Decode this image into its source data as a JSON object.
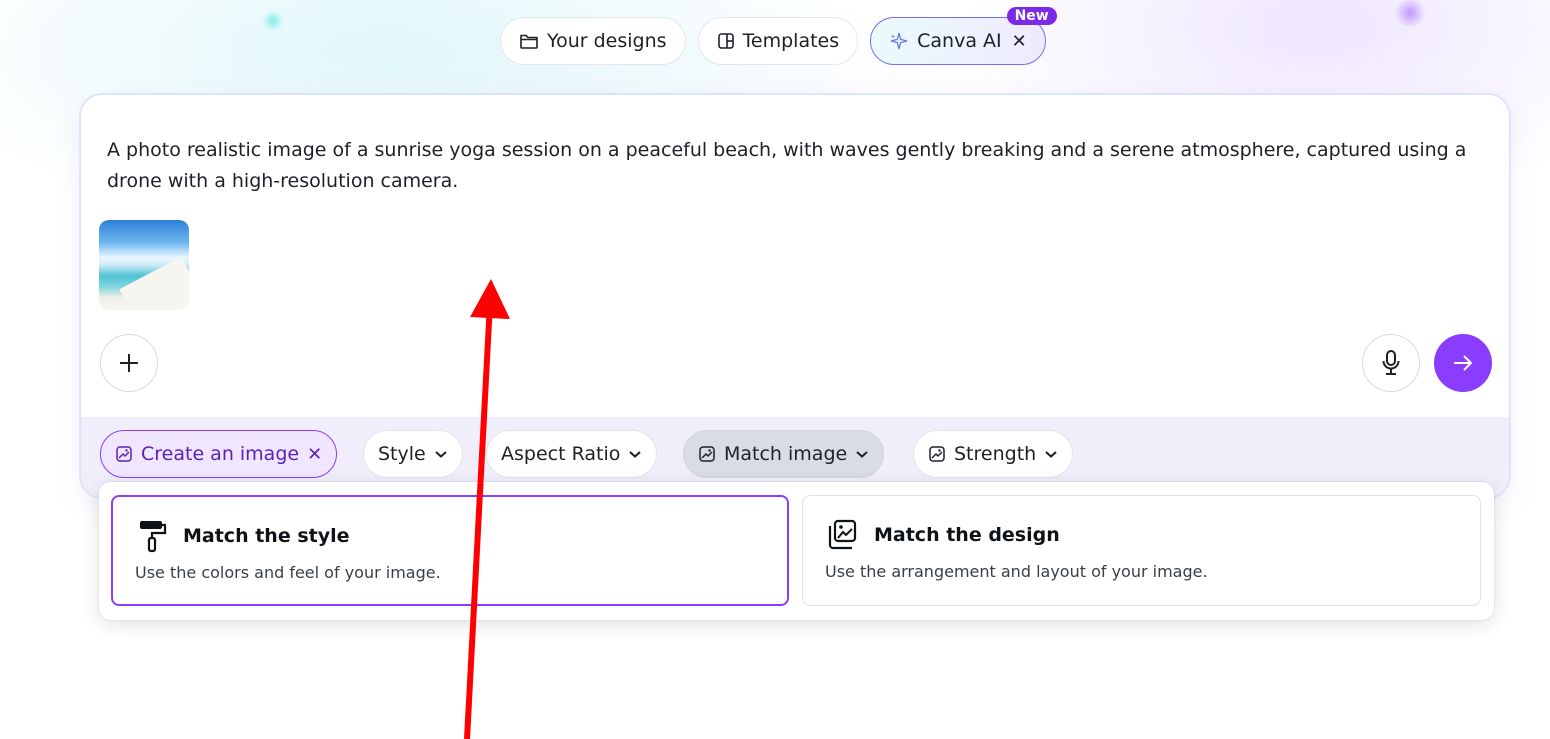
{
  "top_tabs": [
    {
      "label": "Your designs",
      "icon": "folder-icon"
    },
    {
      "label": "Templates",
      "icon": "template-icon"
    },
    {
      "label": "Canva AI",
      "icon": "sparkle-icon",
      "badge": "New",
      "close": "✕"
    }
  ],
  "prompt": {
    "text": "A photo realistic image of a sunrise yoga session on a peaceful beach, with waves gently breaking and a serene atmosphere, captured using a drone with a high-resolution camera.",
    "attachment": "beach-image-thumbnail"
  },
  "actions": {
    "add_icon": "plus-icon",
    "mic_icon": "microphone-icon",
    "send_icon": "arrow-right-icon"
  },
  "options": {
    "create": {
      "label": "Create an image",
      "close": "✕"
    },
    "style": {
      "label": "Style"
    },
    "aspect": {
      "label": "Aspect Ratio"
    },
    "match": {
      "label": "Match image"
    },
    "strength": {
      "label": "Strength"
    }
  },
  "match_menu": [
    {
      "title": "Match the style",
      "desc": "Use the colors and feel of your image.",
      "icon": "paint-roller-icon",
      "selected": true
    },
    {
      "title": "Match the design",
      "desc": "Use the arrangement and layout of your image.",
      "icon": "image-layout-icon",
      "selected": false
    }
  ],
  "colors": {
    "accent": "#8b3dff",
    "annotation_arrow": "#ff0000"
  }
}
